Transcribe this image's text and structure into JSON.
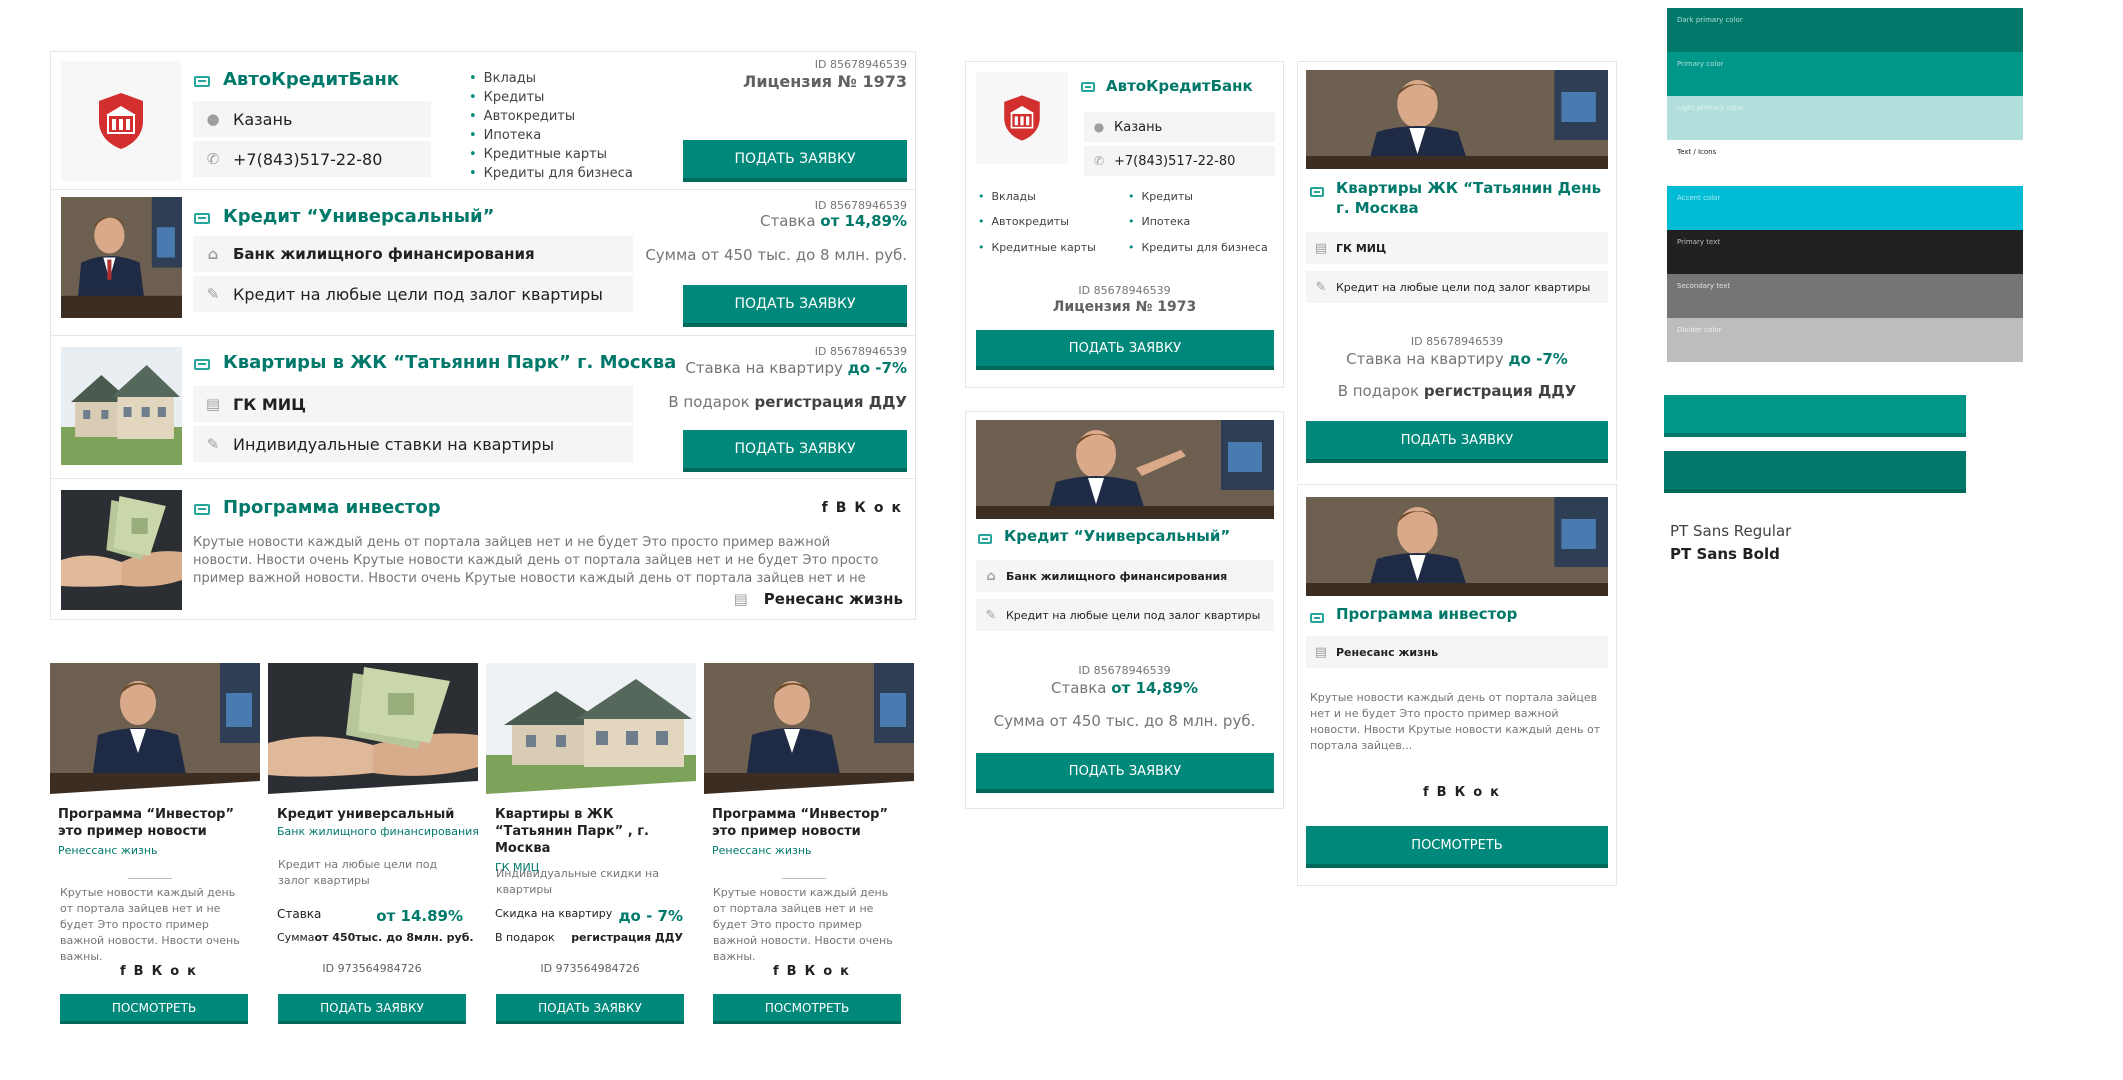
{
  "colors": {
    "accent_green": "#00897b",
    "dark_green": "#00796b",
    "bank_red": "#d32f2f"
  },
  "bank": {
    "name": "АвтоКредитБанк",
    "city": "Казань",
    "phone": "+7(843)517-22-80",
    "id": "ID 85678946539",
    "license": "Лицензия № 1973",
    "services": [
      "Вклады",
      "Кредиты",
      "Автокредиты",
      "Ипотека",
      "Кредитные карты",
      "Кредиты для бизнеса"
    ]
  },
  "credit": {
    "title": "Кредит “Универсальный”",
    "rate_label": "Ставка",
    "rate_value": "от 14,89%",
    "lender": "Банк жилищного финансирования",
    "purpose": "Кредит на любые цели под залог квартиры",
    "amount": "Сумма от 450 тыс. до 8 млн. руб.",
    "id": "ID 85678946539"
  },
  "apartments": {
    "title": "Квартиры в ЖК  “Татьянин Парк” г. Москва",
    "title_alt": "Квартиры ЖК “Татьянин День г. Москва",
    "rate_label": "Ставка на квартиру",
    "rate_value": "до -7%",
    "developer": "ГК МИЦ",
    "note": "Индивидуальные ставки на квартиры",
    "gift_label": "В подарок",
    "gift_value": "регистрация ДДУ",
    "id": "ID 85678946539"
  },
  "investor": {
    "title": "Программа инвестор",
    "text": "Крутые новости каждый день от портала зайцев нет и не будет Это просто пример важной новости. Нвости очень Крутые новости каждый день от портала зайцев нет и не будет Это просто пример важной новости. Нвости очень Крутые новости каждый день от портала зайцев нет и не будет...",
    "text_short": "Крутые новости каждый день от портала зайцев нет и не будет Это просто пример важной новости. Нвости Крутые новости каждый день от портала зайцев...",
    "company": "Ренесанс жизнь",
    "social": [
      "f",
      "ВК",
      "ок"
    ]
  },
  "buttons": {
    "apply": "ПОДАТЬ ЗАЯВКУ",
    "view": "ПОСМОТРЕТЬ"
  },
  "cards": [
    {
      "title": "Программа “Инвестор”  это пример новости",
      "org": "Ренессанс жизнь",
      "desc": "Крутые новости каждый день от портала зайцев нет и не будет Это просто пример важной новости. Нвости очень важны.",
      "button": "ПОСМОТРЕТЬ"
    },
    {
      "title": "Кредит универсальный",
      "org": "Банк жилищного финансирования",
      "desc": "Кредит на любые цели под залог квартиры",
      "k1": "Ставка",
      "v1": "от 14.89%",
      "k2": "Сумма",
      "v2": "от 450тыс. до 8млн. руб.",
      "id": "ID 973564984726",
      "button": "ПОДАТЬ ЗАЯВКУ"
    },
    {
      "title": "Квартиры в ЖК “Татьянин Парк” , г. Москва",
      "org": "ГК МИЦ",
      "desc": "Индивидуальные скидки на квартиры",
      "k1": "Скидка на квартиру",
      "v1": "до - 7%",
      "k2": "В подарок",
      "v2": "регистрация ДДУ",
      "id": "ID 973564984726",
      "button": "ПОДАТЬ ЗАЯВКУ"
    },
    {
      "title": "Программа “Инвестор”  это пример новости",
      "org": "Ренессанс жизнь",
      "desc": "Крутые новости каждый день от портала зайцев нет и не будет Это просто пример важной новости. Нвости очень важны.",
      "button": "ПОСМОТРЕТЬ"
    }
  ],
  "palette": [
    {
      "label": "Dark primary color",
      "color": "#00796b"
    },
    {
      "label": "Primary color",
      "color": "#009688"
    },
    {
      "label": "Light primary color",
      "color": "#b2dfdb"
    },
    {
      "label": "Text / Icons",
      "color": "#ffffff"
    },
    {
      "label": "Accent color",
      "color": "#00bcd4"
    },
    {
      "label": "Primary text",
      "color": "#212121"
    },
    {
      "label": "Secondary text",
      "color": "#757575"
    },
    {
      "label": "Divider color",
      "color": "#bdbdbd"
    }
  ],
  "swatches": [
    "#009688",
    "#00796b"
  ],
  "fonts": {
    "regular": "PT Sans Regular",
    "bold": "PT Sans Bold"
  }
}
